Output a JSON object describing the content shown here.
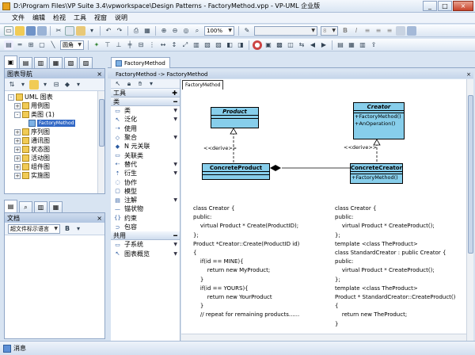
{
  "window": {
    "title": "D:\\Program Files\\VP Suite 3.4\\vpworkspace\\Design Patterns - FactoryMethod.vpp - VP-UML 企业版",
    "min": "_",
    "max": "□",
    "close": "×"
  },
  "menu": [
    "文件",
    "编辑",
    "检视",
    "工具",
    "视窗",
    "说明"
  ],
  "toolbar": {
    "zoom": "100%",
    "font_size": "8",
    "shape_label": "圆角"
  },
  "diagram_navigator": {
    "title": "图表导航",
    "tree": [
      {
        "label": "UML 图表",
        "level": 0,
        "expanded": "-"
      },
      {
        "label": "用例图",
        "level": 1,
        "expanded": "+"
      },
      {
        "label": "类图 (1)",
        "level": 1,
        "expanded": "-"
      },
      {
        "label": "FactoryMethod",
        "level": 2,
        "expanded": "",
        "selected": true
      },
      {
        "label": "序列图",
        "level": 1,
        "expanded": "+"
      },
      {
        "label": "通讯图",
        "level": 1,
        "expanded": "+"
      },
      {
        "label": "状态图",
        "level": 1,
        "expanded": "+"
      },
      {
        "label": "活动图",
        "level": 1,
        "expanded": "+"
      },
      {
        "label": "组件图",
        "level": 1,
        "expanded": "+"
      },
      {
        "label": "实施图",
        "level": 1,
        "expanded": "+"
      }
    ]
  },
  "doc_panel": {
    "title": "文档",
    "combo": "超文件标示语言",
    "bold": "B"
  },
  "editor": {
    "tab": "FactoryMethod",
    "breadcrumb": "FactoryMethod -> FactoryMethod",
    "canvas_tab": "FactoryMethod"
  },
  "palette": {
    "groups": [
      "工具",
      "类",
      "共用"
    ],
    "tools_items": [],
    "class_items": [
      {
        "label": "类",
        "dd": true
      },
      {
        "label": "泛化",
        "dd": true
      },
      {
        "label": "使用",
        "dd": false
      },
      {
        "label": "聚合",
        "dd": true
      },
      {
        "label": "N 元关联",
        "dd": false
      },
      {
        "label": "关联类",
        "dd": false
      },
      {
        "label": "替代",
        "dd": true
      },
      {
        "label": "衍生",
        "dd": true
      },
      {
        "label": "协作",
        "dd": false
      },
      {
        "label": "模型",
        "dd": false
      },
      {
        "label": "注解",
        "dd": true
      },
      {
        "label": "锚状物",
        "dd": false
      },
      {
        "label": "约束",
        "dd": false
      },
      {
        "label": "包容",
        "dd": false
      }
    ],
    "common_items": [
      {
        "label": "子系统",
        "dd": true
      },
      {
        "label": "图表概览",
        "dd": true
      }
    ]
  },
  "diagram": {
    "product": {
      "name": "Product"
    },
    "creator": {
      "name": "Creator",
      "ops": [
        "+FactoryMethod()",
        "+AnOperation()"
      ]
    },
    "concrete_product": {
      "name": "ConcreteProduct"
    },
    "concrete_creator": {
      "name": "ConcreteCreator",
      "ops": [
        "+FactoryMethod()"
      ]
    },
    "derive1": "<<derive>>",
    "derive2": "<<derive>>"
  },
  "code_left": "class Creator {\npublic:\n    virtual Product * Create(ProductID);\n};\nProduct *Creator::Create(ProductID id)\n{\n    if(id == MINE){\n        return new MyProduct;\n    }\n    if(id == YOURS){\n        return new YourProduct\n    }\n    // repeat for remaining products......",
  "code_right": "class Creator {\npublic:\n    virtual Product * CreateProduct();\n};\ntemplate <class TheProduct>\nclass StandardCreator : public Creator {\npublic:\n    virtual Product * CreateProduct();\n};\ntemplate <class TheProduct>\nProduct * StandardCreator::CreateProduct()\n{\n    return new TheProduct;\n}",
  "status": {
    "label": "消息"
  }
}
